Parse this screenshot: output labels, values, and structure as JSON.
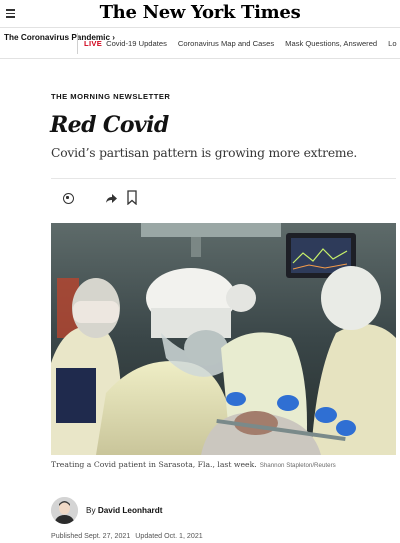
{
  "header": {
    "logo": "The New York Times",
    "menu_icon": "hamburger-menu-icon"
  },
  "nav": {
    "section_title": "The Coronavirus Pandemic ›",
    "live_badge": "LIVE",
    "links": [
      "Covid-19 Updates",
      "Coronavirus Map and Cases",
      "Mask Questions, Answered",
      "Lo"
    ]
  },
  "article": {
    "kicker": "THE MORNING NEWSLETTER",
    "headline": "Red Covid",
    "summary": "Covid’s partisan pattern is growing more extreme.",
    "share_icons": [
      "whatsapp-icon",
      "share-icon",
      "bookmark-icon"
    ],
    "caption": "Treating a Covid patient in Sarasota, Fla., last week.",
    "credit": "Shannon Stapleton/Reuters",
    "byline_prefix": "By",
    "author": "David Leonhardt",
    "published": "Published Sept. 27, 2021",
    "updated": "Updated Oct. 1, 2021"
  },
  "colors": {
    "live": "#d0021b",
    "text": "#121212"
  }
}
